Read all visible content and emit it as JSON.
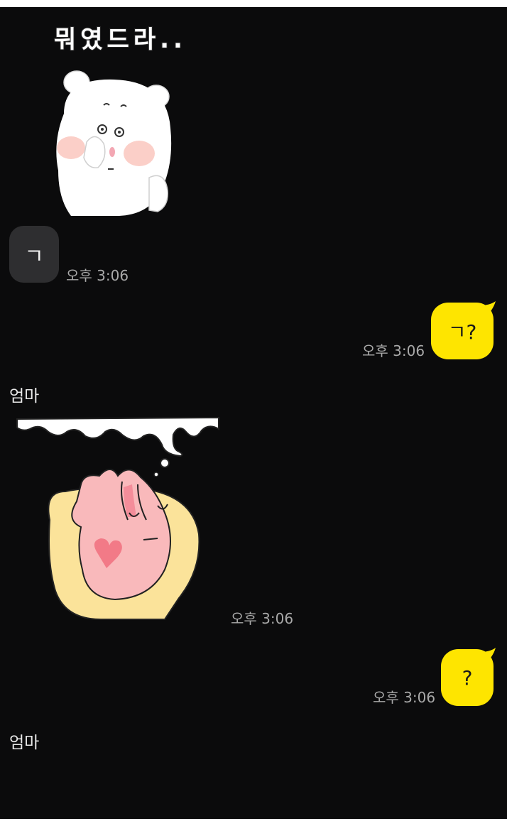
{
  "messages": [
    {
      "type": "sticker",
      "sender_side": "left",
      "caption": "뭐였드라..",
      "sticker": "white-bear-thinking-sticker"
    },
    {
      "type": "text",
      "sender_side": "left",
      "text": "ㄱ",
      "time": "오후 3:06"
    },
    {
      "type": "text",
      "sender_side": "right",
      "text": "ㄱ?",
      "time": "오후 3:06"
    },
    {
      "type": "sticker",
      "sender_side": "left",
      "sender": "엄마",
      "sticker": "pink-rabbit-sleeping-sticker",
      "time": "오후 3:06"
    },
    {
      "type": "text",
      "sender_side": "right",
      "text": "?",
      "time": "오후 3:06"
    },
    {
      "type": "sender-label",
      "sender": "엄마"
    }
  ],
  "colors": {
    "background": "#0b0b0c",
    "bubble_other": "#2e2e30",
    "bubble_mine": "#fee500",
    "timestamp": "#a9a9a9"
  }
}
